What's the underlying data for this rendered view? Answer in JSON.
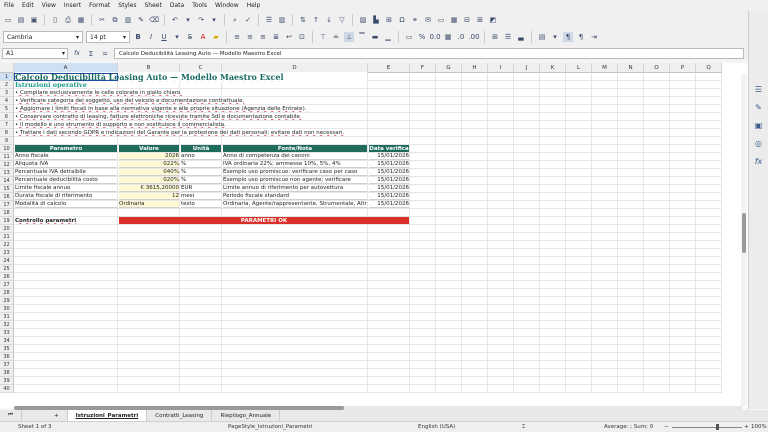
{
  "menu": [
    "File",
    "Edit",
    "View",
    "Insert",
    "Format",
    "Styles",
    "Sheet",
    "Data",
    "Tools",
    "Window",
    "Help"
  ],
  "toolbar": {
    "font_name": "Cambria",
    "font_size": "14 pt",
    "bold": "B",
    "italic": "I",
    "underline": "U"
  },
  "formula": {
    "cell_ref": "A1",
    "content": "Calcolo Deducibilità Leasing Auto — Modello Maestro Excel",
    "fx": "fx",
    "sigma": "Σ",
    "equals": "="
  },
  "columns": [
    "A",
    "B",
    "C",
    "D",
    "E",
    "F",
    "G",
    "H",
    "I",
    "J",
    "K",
    "L",
    "M",
    "N",
    "O",
    "P",
    "Q"
  ],
  "rows": [
    "1",
    "2",
    "3",
    "4",
    "5",
    "6",
    "7",
    "8",
    "9",
    "10",
    "11",
    "12",
    "13",
    "14",
    "15",
    "16",
    "17",
    "18",
    "19",
    "20",
    "21",
    "22",
    "23",
    "24",
    "25",
    "26",
    "27",
    "28",
    "29",
    "30",
    "31",
    "32",
    "33",
    "34",
    "35",
    "36",
    "37",
    "38",
    "39",
    "40"
  ],
  "sheet": {
    "title": "Calcolo Deducibilità Leasing Auto — Modello Maestro Excel",
    "instructions_heading": "Istruzioni operative",
    "instructions": [
      "• Compilare esclusivamente le celle colorate in giallo chiaro.",
      "• Verificare categoria del soggetto, uso del veicolo e documentazione contrattuale.",
      "• Aggiornare i limiti fiscali in base alla normativa vigente e alle proprie situazione (Agenzia delle Entrate).",
      "• Conservare contratto di leasing, fatture elettroniche ricevute tramite SdI e documentazione contabile.",
      "• Il modello è uno strumento di supporto e non sostituisce il commercialista.",
      "• Trattare i dati secondo GDPR e indicazioni del Garante per la protezione dei dati personali; evitare dati non necessari."
    ],
    "table_headers": [
      "Parametro",
      "Valore",
      "Unità",
      "Fonte/Nota",
      "Data verifica"
    ],
    "table_rows": [
      [
        "Anno fiscale",
        "2026",
        "anno",
        "Anno di competenza dei canoni",
        "15/01/2026"
      ],
      [
        "Aliquota IVA",
        "022%",
        "%",
        "IVA ordinaria 22%; ammesse 10%, 5%, 4%",
        "15/01/2026"
      ],
      [
        "Percentuale IVA detraibile",
        "040%",
        "%",
        "Esempio uso promiscuo: verificare caso per caso",
        "15/01/2026"
      ],
      [
        "Percentuale deducibilità costo",
        "020%",
        "%",
        "Esempio uso promiscuo non agente; verificare",
        "15/01/2026"
      ],
      [
        "Limite fiscale annuo",
        "€ 3615,20000",
        "EUR",
        "Limite annuo di riferimento per autovettura",
        "15/01/2026"
      ],
      [
        "Durata fiscale di riferimento",
        "12",
        "mesi",
        "Periodo fiscale standard",
        "15/01/2026"
      ],
      [
        "Modalità di calcolo",
        "Ordinaria",
        "testo",
        "Ordinaria, Agente/rappresentante, Strumentale, Altro",
        "15/01/2026"
      ]
    ],
    "check_label": "Controllo parametri",
    "check_status": "PARAMETRI OK"
  },
  "tabs": [
    "Istruzioni_Parametri",
    "Contratti_Leasing",
    "Riepilogo_Annuale"
  ],
  "status": {
    "sheet": "Sheet 1 of 3",
    "page_style": "PageStyle_Istruzioni_Parametri",
    "language": "English (USA)",
    "summary": "Average: ; Sum: 0",
    "zoom": "100%"
  },
  "colors": {
    "header_green": "#1f6b5e",
    "title_teal": "#1a6b63",
    "input_yellow": "#fef9d5",
    "status_red": "#d9302a",
    "selection_blue": "#cfe0f2"
  }
}
